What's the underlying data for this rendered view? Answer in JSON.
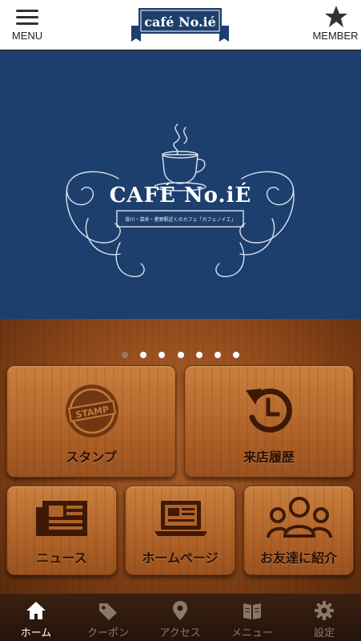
{
  "header": {
    "menu_label": "MENU",
    "member_label": "MEMBER",
    "logo_text": "café No.ié"
  },
  "hero": {
    "title": "CAFÉ No.iÉ",
    "subtitle": "掛川・袋井・愛野駅近くのカフェ「カフェノイエ」",
    "slides_total": 7,
    "active_slide": 1
  },
  "tiles": {
    "stamp": {
      "label": "スタンプ",
      "icon_text": "STAMP"
    },
    "history": {
      "label": "来店履歴"
    },
    "news": {
      "label": "ニュース"
    },
    "homepage": {
      "label": "ホームページ"
    },
    "invite": {
      "label": "お友達に紹介"
    }
  },
  "tabbar": {
    "items": [
      {
        "label": "ホーム",
        "icon": "home-icon",
        "active": true
      },
      {
        "label": "クーポン",
        "icon": "tag-icon",
        "active": false
      },
      {
        "label": "アクセス",
        "icon": "map-pin-icon",
        "active": false
      },
      {
        "label": "メニュー",
        "icon": "book-icon",
        "active": false
      },
      {
        "label": "設定",
        "icon": "gear-icon",
        "active": false
      }
    ]
  },
  "colors": {
    "hero_bg": "#1d3f6e",
    "logo_navy": "#1d3f6e",
    "tab_active": "#ffffff",
    "tab_inactive": "#8a7868"
  }
}
